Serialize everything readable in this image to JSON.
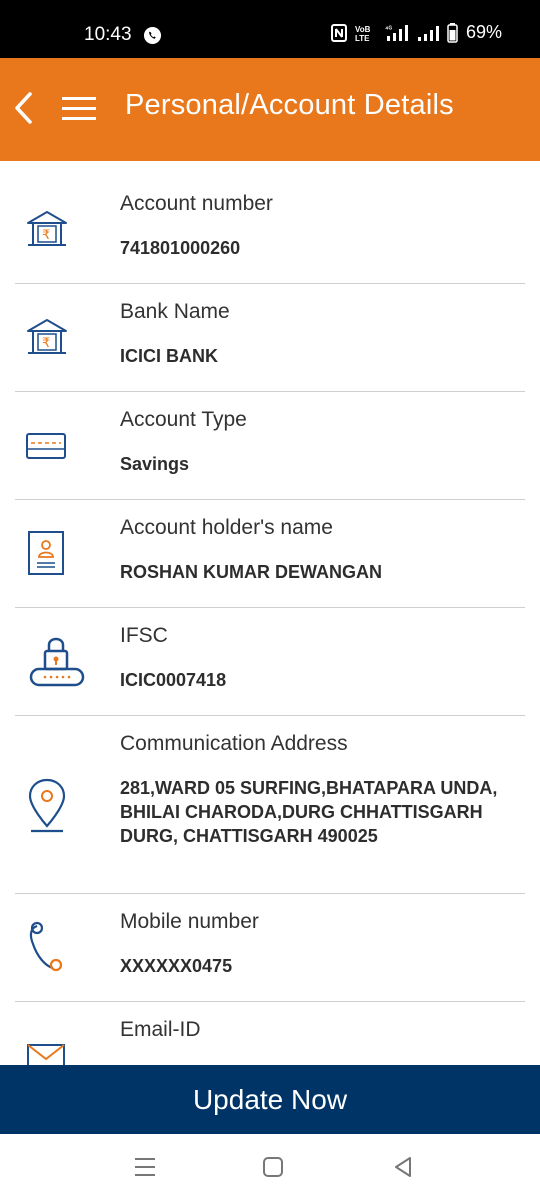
{
  "status_bar": {
    "time": "10:43",
    "battery": "69%"
  },
  "header": {
    "title": "Personal/Account Details",
    "color": "#e8781b"
  },
  "details": [
    {
      "icon": "bank-icon",
      "label": "Account number",
      "value": "741801000260"
    },
    {
      "icon": "bank-icon",
      "label": "Bank Name",
      "value": "ICICI BANK"
    },
    {
      "icon": "card-icon",
      "label": "Account Type",
      "value": "Savings"
    },
    {
      "icon": "id-card-icon",
      "label": "Account holder's name",
      "value": "ROSHAN KUMAR DEWANGAN"
    },
    {
      "icon": "lock-icon",
      "label": "IFSC",
      "value": "ICIC0007418"
    },
    {
      "icon": "location-pin-icon",
      "label": "Communication Address",
      "value": "281,WARD 05 SURFING,BHATAPARA UNDA, BHILAI CHARODA,DURG CHHATTISGARH DURG, CHATTISGARH 490025"
    },
    {
      "icon": "phone-icon",
      "label": "Mobile number",
      "value": "XXXXXX0475"
    },
    {
      "icon": "mail-icon",
      "label": "Email-ID",
      "value": ""
    }
  ],
  "cta": {
    "label": "Update Now",
    "color": "#003366"
  },
  "nav_bar": {
    "buttons": [
      "recents-icon",
      "home-icon",
      "back-icon"
    ]
  }
}
